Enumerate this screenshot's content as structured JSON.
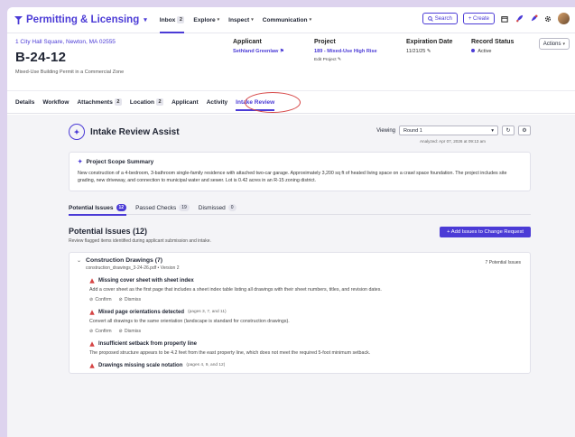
{
  "nav": {
    "brand": "Permitting & Licensing",
    "links": [
      {
        "label": "Inbox",
        "badge": "2"
      },
      {
        "label": "Explore"
      },
      {
        "label": "Inspect"
      },
      {
        "label": "Communication"
      }
    ],
    "search_label": "Search",
    "create_label": "+ Create"
  },
  "record": {
    "address": "1 City Hall Square, Newton, MA 02555",
    "id": "B-24-12",
    "description": "Mixed-Use Building Permit in a Commercial Zone",
    "applicant_label": "Applicant",
    "applicant": "Sethland Greenlaw",
    "project_label": "Project",
    "project": "189 - Mixed-Use High Rise",
    "edit_project": "Edit Project",
    "expiration_label": "Expiration Date",
    "expiration": "11/21/25",
    "status_label": "Record Status",
    "status": "Active",
    "actions_label": "Actions"
  },
  "tabs": [
    {
      "label": "Details"
    },
    {
      "label": "Workflow"
    },
    {
      "label": "Attachments",
      "badge": "2"
    },
    {
      "label": "Location",
      "badge": "2"
    },
    {
      "label": "Applicant"
    },
    {
      "label": "Activity"
    },
    {
      "label": "Intake Review"
    }
  ],
  "assist": {
    "title": "Intake Review Assist",
    "viewing_label": "Viewing",
    "round": "Round 1",
    "analyzed": "Analyzed: Apr 07, 2026 at 09:13 am",
    "scope_title": "Project Scope Summary",
    "scope_text": "New construction of a 4-bedroom, 3-bathroom single-family residence with attached two-car garage. Approximately 3,200 sq ft of heated living space on a crawl space foundation. The project includes site grading, new driveway, and connection to municipal water and sewer. Lot is 0.42 acres in an R-15 zoning district."
  },
  "subtabs": [
    {
      "label": "Potential Issues",
      "count": "12"
    },
    {
      "label": "Passed Checks",
      "count": "19"
    },
    {
      "label": "Dismissed",
      "count": "0"
    }
  ],
  "issues_section": {
    "title": "Potential Issues (12)",
    "subtitle": "Review flagged items identified during applicant submission and intake.",
    "add_button": "+ Add Issues to Change Request"
  },
  "group": {
    "title": "Construction Drawings (7)",
    "file": "construction_drawings_3-24-26.pdf • Version 2",
    "count": "7 Potential Issues"
  },
  "issues": [
    {
      "title": "Missing cover sheet with sheet index",
      "pages": "",
      "desc": "Add a cover sheet as the first page that includes a sheet index table listing all drawings with their sheet numbers, titles, and revision dates."
    },
    {
      "title": "Mixed page orientations detected",
      "pages": "(pages 3, 7, and 11)",
      "desc": "Convert all drawings to the same orientation (landscape is standard for construction drawings)."
    },
    {
      "title": "Insufficient setback from property line",
      "pages": "",
      "desc": "The proposed structure appears to be 4.2 feet from the east property line, which does not meet the required 5-foot minimum setback."
    },
    {
      "title": "Drawings missing scale notation",
      "pages": "(pages 4, 9, and 12)",
      "desc": ""
    }
  ],
  "issue_actions": {
    "confirm": "Confirm",
    "dismiss": "Dismiss"
  },
  "colors": {
    "accent": "#4b3bd6",
    "warning": "#d64545",
    "highlight": "#d64545"
  }
}
